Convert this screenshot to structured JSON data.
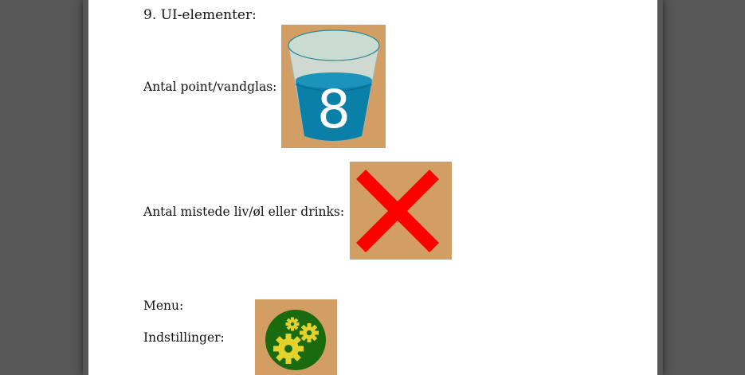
{
  "document": {
    "section_heading": "9. UI-elementer:",
    "rows": [
      {
        "label": "Antal point/vandglas:",
        "icon": "water-glass-icon",
        "icon_value": "8"
      },
      {
        "label": "Antal mistede liv/øl eller drinks:",
        "icon": "red-x-icon"
      },
      {
        "label": "Menu:"
      },
      {
        "label": "Indstillinger:",
        "icon": "gears-icon"
      }
    ]
  },
  "colors": {
    "icon_background": "#d39e63",
    "water": "#0a7fa8",
    "cross": "#ff0000",
    "gear_circle": "#1a6b0f",
    "gear": "#e4d22a"
  }
}
